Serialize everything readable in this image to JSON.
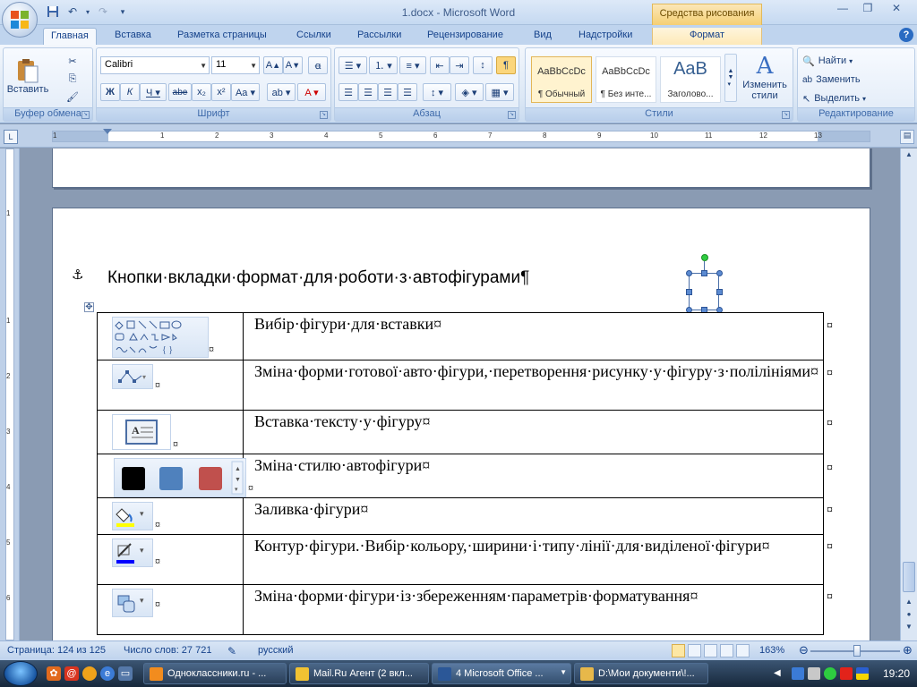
{
  "window": {
    "title": "1.docx - Microsoft Word",
    "context_tab_group": "Средства рисования"
  },
  "tabs": [
    {
      "label": "Главная",
      "active": true
    },
    {
      "label": "Вставка"
    },
    {
      "label": "Разметка страницы"
    },
    {
      "label": "Ссылки"
    },
    {
      "label": "Рассылки"
    },
    {
      "label": "Рецензирование"
    },
    {
      "label": "Вид"
    },
    {
      "label": "Надстройки"
    },
    {
      "label": "Формат",
      "contextual": true
    }
  ],
  "ribbon": {
    "clipboard": {
      "label": "Буфер обмена",
      "paste": "Вставить"
    },
    "font": {
      "label": "Шрифт",
      "family": "Calibri",
      "size": "11"
    },
    "paragraph": {
      "label": "Абзац"
    },
    "styles": {
      "label": "Стили",
      "items": [
        {
          "sample": "AaBbCcDc",
          "name": "¶ Обычный",
          "selected": true
        },
        {
          "sample": "AaBbCcDc",
          "name": "¶ Без инте..."
        },
        {
          "sample": "AaB",
          "name": "Заголово..."
        }
      ],
      "change_styles": "Изменить стили"
    },
    "editing": {
      "label": "Редактирование",
      "find": "Найти",
      "replace": "Заменить",
      "select": "Выделить"
    }
  },
  "ruler": {
    "numbers": [
      "1",
      "1",
      "2",
      "3",
      "4",
      "5",
      "6",
      "7",
      "8",
      "9",
      "10",
      "11",
      "12",
      "13"
    ],
    "vnumbers": [
      "1",
      "1",
      "2",
      "3",
      "4",
      "5",
      "6"
    ]
  },
  "document": {
    "heading": "Кнопки·вкладки·формат·для·роботи·з·автофігурами¶",
    "cell_mark": "¤",
    "rows": [
      {
        "text": "Вибір·фігури·для·вставки¤",
        "icon": "shapes-gallery-icon"
      },
      {
        "text": "Зміна·форми·готової·авто·фігури,·перетворення·рисунку·у·фігуру·з·полілініями¤",
        "icon": "edit-points-icon"
      },
      {
        "text": "Вставка·тексту·у·фігуру¤",
        "icon": "text-box-icon"
      },
      {
        "text": "Зміна·стилю·автофігури¤",
        "icon": "shape-styles-icon"
      },
      {
        "text": "Заливка·фігури¤",
        "icon": "shape-fill-icon"
      },
      {
        "text": "Контур·фігури.·Вибір·кольору,·ширини·і·типу·лінії·для·виділеної·фігури¤",
        "icon": "shape-outline-icon"
      },
      {
        "text": "Зміна·форми·фігури·із·збереженням·параметрів·форматування¤",
        "icon": "change-shape-icon"
      }
    ]
  },
  "statusbar": {
    "page": "Страница: 124 из 125",
    "words": "Число слов: 27 721",
    "language": "русский",
    "zoom": "163%"
  },
  "taskbar": {
    "tasks": [
      {
        "label": "Одноклассники.ru - ...",
        "color": "#f28c1e"
      },
      {
        "label": "Mail.Ru Агент (2 вкл...",
        "color": "#f1c232"
      },
      {
        "label": "4 Microsoft Office ...",
        "color": "#2b5797",
        "active": true
      },
      {
        "label": "D:\\Мои документи\\!...",
        "color": "#e7b84a"
      }
    ],
    "clock": "19:20"
  },
  "colors": {
    "style_black": "#000000",
    "style_blue": "#4f81bd",
    "style_red": "#c0504d",
    "fill_yellow": "#ffff00",
    "outline_blue": "#0000ff"
  }
}
